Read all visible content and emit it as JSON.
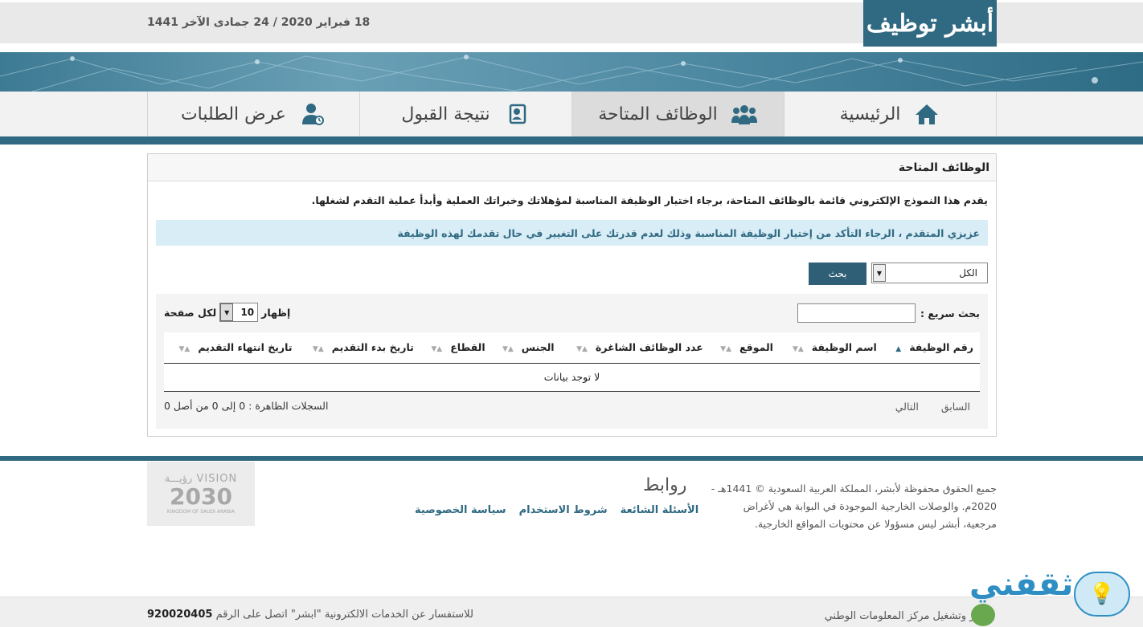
{
  "header": {
    "logo_text": "أبشر توظيف",
    "date": "18 فبراير 2020 / 24 جمادى الآخر 1441"
  },
  "nav": {
    "items": [
      {
        "label": "الرئيسية",
        "icon": "home-icon"
      },
      {
        "label": "الوظائف المتاحة",
        "icon": "users-icon",
        "active": true
      },
      {
        "label": "نتيجة القبول",
        "icon": "search-person-icon"
      },
      {
        "label": "عرض الطلبات",
        "icon": "user-clock-icon"
      }
    ]
  },
  "panel": {
    "title": "الوظائف المتاحة",
    "intro": "يقدم هذا النموذج الإلكتروني قائمة بالوظائف المتاحة، برجاء اختيار الوظيفة المناسبة لمؤهلاتك وخبراتك العملية وأبدأ عملية التقدم لشغلها.",
    "notice": "عزيزي المتقدم ، الرجاء التأكد من إختيار الوظيفة المناسبة وذلك لعدم قدرتك على التغيير في حال تقدمك لهذه الوظيفة",
    "filter_value": "الكل",
    "search_button": "بحث",
    "quick_search_label": "بحث سريع :",
    "show_label": "إظهار",
    "per_page_value": "10",
    "per_page_suffix": "لكل صفحة",
    "columns": [
      "رقم الوظيفة",
      "اسم الوظيفة",
      "الموقع",
      "عدد الوظائف الشاغرة",
      "الجنس",
      "القطاع",
      "تاريخ بدء التقديم",
      "تاريخ انتهاء التقديم"
    ],
    "empty_text": "لا توجد بيانات",
    "prev": "السابق",
    "next": "التالي",
    "records_text": "السجلات الظاهرة : 0 إلى 0 من أصل 0"
  },
  "footer": {
    "copyright": "جميع الحقوق محفوظة لأبشر، المملكة العربية السعودية © 1441هـ - 2020م. والوصلات الخارجية الموجودة في البوابة هي لأغراض مرجعية، أبشر ليس مسؤولا عن محتويات المواقع الخارجية.",
    "links_title": "روابط",
    "links": [
      "الأسئلة الشائعة",
      "شروط الاستخدام",
      "سياسة الخصوصية"
    ],
    "vision_top": "VISION رؤيـــة",
    "vision_year": "2030",
    "vision_country": "KINGDOM OF SAUDI ARABIA",
    "contact_text": "للاستفسار عن الخدمات الالكترونية \"ابشر\" اتصل على الرقم",
    "contact_number": "920020405",
    "developer": "تطوير وتشغيل مركز المعلومات الوطني",
    "brand": "ثقفني"
  }
}
